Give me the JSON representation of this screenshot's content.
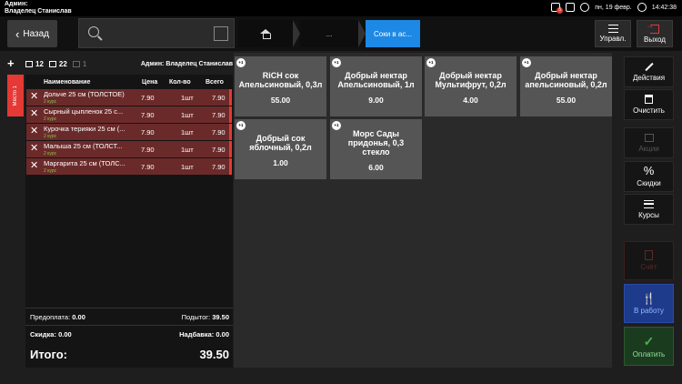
{
  "status_bar": {
    "user_title": "Админ:",
    "user_name": "Владелец Станислав",
    "notification_count": "5",
    "date": "пн, 19 февр.",
    "time": "14:42:38"
  },
  "topbar": {
    "back_label": "Назад",
    "search_placeholder": "",
    "breadcrumb_mid": "...",
    "breadcrumb_active": "Соки в ас...",
    "manage_label": "Управл.",
    "exit_label": "Выход"
  },
  "order_info": {
    "table_number": "12",
    "check_number": "22",
    "guests": "1",
    "waiter": "Админ: Владелец Станислав",
    "place_tab": "Место 1"
  },
  "order_table": {
    "headers": {
      "name": "Наименование",
      "price": "Цена",
      "qty": "Кол-во",
      "total": "Всего"
    },
    "rows": [
      {
        "name": "Дольче 25 см (ТОЛСТОЕ)",
        "course": "2 курс",
        "price": "7.90",
        "qty": "1шт",
        "total": "7.90"
      },
      {
        "name": "Сырный цыпленок 25 с...",
        "course": "2 курс",
        "price": "7.90",
        "qty": "1шт",
        "total": "7.90"
      },
      {
        "name": "Курочка терияки 25 см (...",
        "course": "2 курс",
        "price": "7.90",
        "qty": "1шт",
        "total": "7.90"
      },
      {
        "name": "Малыша 25 см (ТОЛСТ...",
        "course": "2 курс",
        "price": "7.90",
        "qty": "1шт",
        "total": "7.90"
      },
      {
        "name": "Маргарита 25 см (ТОЛС...",
        "course": "2 курс",
        "price": "7.90",
        "qty": "1шт",
        "total": "7.90"
      }
    ]
  },
  "summary": {
    "prepayment_label": "Предоплата:",
    "prepayment_value": "0.00",
    "subtotal_label": "Подытог:",
    "subtotal_value": "39.50",
    "discount_label": "Скидка:",
    "discount_value": "0.00",
    "surcharge_label": "Надбавка:",
    "surcharge_value": "0.00",
    "total_label": "Итого:",
    "total_value": "39.50"
  },
  "products": [
    {
      "badge": "+1",
      "name": "RiCH сок Апельсиновый, 0,3л",
      "price": "55.00"
    },
    {
      "badge": "+1",
      "name": "Добрый нектар Апельсиновый, 1л",
      "price": "9.00"
    },
    {
      "badge": "+1",
      "name": "Добрый нектар Мультифрут, 0,2л",
      "price": "4.00"
    },
    {
      "badge": "+1",
      "name": "Добрый нектар апельсиновый, 0,2л",
      "price": "55.00"
    },
    {
      "badge": "+1",
      "name": "Добрый сок яблочный, 0,2л",
      "price": "1.00"
    },
    {
      "badge": "+1",
      "name": "Морс Сады придонья, 0,3 стекло",
      "price": "6.00"
    }
  ],
  "side_actions": {
    "actions": "Действия",
    "clear": "Очистить",
    "promos": "Акции",
    "discounts": "Скидки",
    "courses": "Курсы",
    "bill": "Счёт",
    "to_work": "В работу",
    "pay": "Оплатить"
  },
  "colors": {
    "accent_blue": "#1e88e5",
    "row_red": "#6b2a2a",
    "alert_red": "#e53935",
    "tile_grey": "#555555"
  }
}
